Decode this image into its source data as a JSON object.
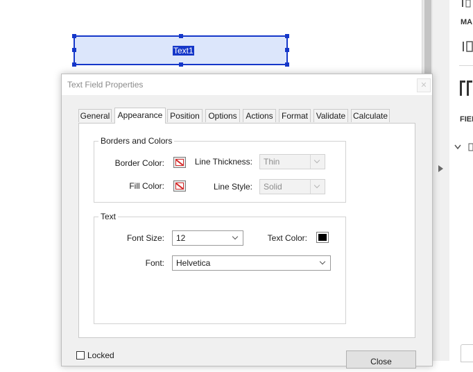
{
  "canvas": {
    "field_label": "Text1"
  },
  "side_panel": {
    "text_ma": "MA",
    "text_fiel": "FIEL"
  },
  "dialog": {
    "title": "Text Field Properties",
    "close_glyph": "✕",
    "tabs": [
      {
        "label": "General"
      },
      {
        "label": "Appearance"
      },
      {
        "label": "Position"
      },
      {
        "label": "Options"
      },
      {
        "label": "Actions"
      },
      {
        "label": "Format"
      },
      {
        "label": "Validate"
      },
      {
        "label": "Calculate"
      }
    ],
    "active_tab": "Appearance",
    "borders_group": {
      "title": "Borders and Colors",
      "border_color_label": "Border Color:",
      "fill_color_label": "Fill Color:",
      "line_thickness_label": "Line Thickness:",
      "line_thickness_value": "Thin",
      "line_style_label": "Line Style:",
      "line_style_value": "Solid",
      "border_color": "transparent",
      "fill_color": "transparent"
    },
    "text_group": {
      "title": "Text",
      "font_size_label": "Font Size:",
      "font_size_value": "12",
      "text_color_label": "Text Color:",
      "text_color": "#000000",
      "font_label": "Font:",
      "font_value": "Helvetica"
    },
    "locked_label": "Locked",
    "locked_checked": false,
    "close_button_label": "Close"
  },
  "icons": {
    "collapse": "chevron-right-icon",
    "panel_toggle": "chevron-down-icon"
  }
}
